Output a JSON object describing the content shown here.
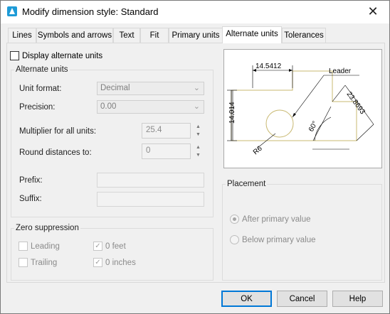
{
  "window": {
    "title": "Modify dimension style: Standard",
    "close_glyph": "✕"
  },
  "tabs": [
    {
      "label": "Lines"
    },
    {
      "label": "Symbols and arrows"
    },
    {
      "label": "Text"
    },
    {
      "label": "Fit"
    },
    {
      "label": "Primary units"
    },
    {
      "label": "Alternate units",
      "active": true
    },
    {
      "label": "Tolerances"
    }
  ],
  "display_alternate": {
    "label": "Display alternate units",
    "checked": false
  },
  "alternate_units": {
    "title": "Alternate units",
    "unit_format": {
      "label": "Unit format:",
      "value": "Decimal"
    },
    "precision": {
      "label": "Precision:",
      "value": "0.00"
    },
    "multiplier": {
      "label": "Multiplier for all units:",
      "value": "25.4"
    },
    "round": {
      "label": "Round distances to:",
      "value": "0"
    },
    "prefix": {
      "label": "Prefix:",
      "value": ""
    },
    "suffix": {
      "label": "Suffix:",
      "value": ""
    }
  },
  "zero_suppression": {
    "title": "Zero suppression",
    "leading": {
      "label": "Leading",
      "checked": false
    },
    "trailing": {
      "label": "Trailing",
      "checked": false
    },
    "feet": {
      "label": "0 feet",
      "checked": true
    },
    "inches": {
      "label": "0 inches",
      "checked": true
    }
  },
  "preview": {
    "dim_top": "14.5412",
    "dim_left": "14.014",
    "dim_diag": "23.8693",
    "leader": "Leader",
    "angle": "60°",
    "radius": "R6"
  },
  "placement": {
    "title": "Placement",
    "after": {
      "label": "After primary value",
      "selected": true
    },
    "below": {
      "label": "Below primary value",
      "selected": false
    }
  },
  "buttons": {
    "ok": "OK",
    "cancel": "Cancel",
    "help": "Help"
  },
  "colors": {
    "accent": "#0078d7",
    "preview_outline": "#c8b870"
  }
}
